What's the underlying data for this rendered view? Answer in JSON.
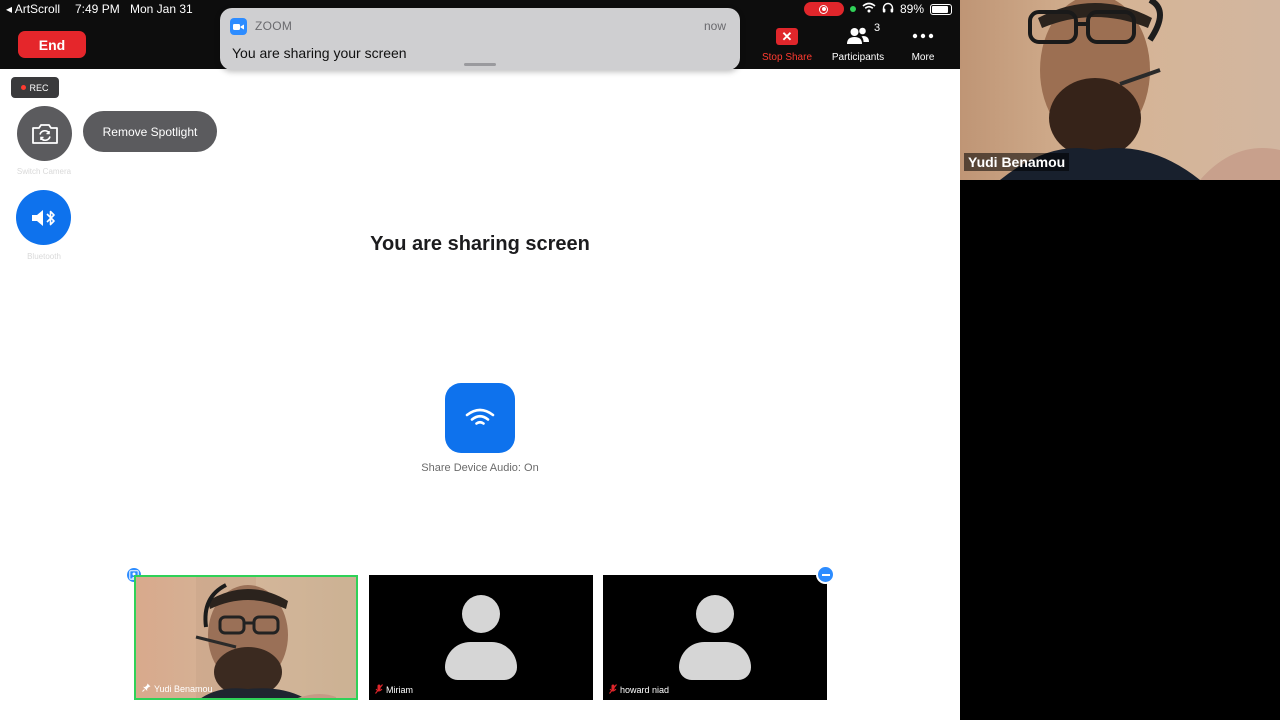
{
  "status_bar": {
    "back_app": "◂ ArtScroll",
    "time": "7:49 PM",
    "date": "Mon Jan 31",
    "battery": "89%"
  },
  "end_button": "End",
  "notification": {
    "app": "ZOOM",
    "time": "now",
    "message": "You are sharing your screen"
  },
  "toolbar": {
    "stop_share": "Stop Share",
    "participants": "Participants",
    "participants_count": "3",
    "more": "More"
  },
  "controls": {
    "rec": "REC",
    "switch_camera_label": "Switch Camera",
    "bluetooth_label": "Bluetooth",
    "remove_spotlight": "Remove Spotlight"
  },
  "main": {
    "title": "You are sharing screen",
    "audio_label": "Share Device Audio: On"
  },
  "thumbnails": [
    {
      "name": "Yudi Benamou"
    },
    {
      "name": "Miriam"
    },
    {
      "name": "howard niad"
    }
  ],
  "webcam": {
    "name": "Yudi Benamou"
  },
  "colors": {
    "accent_blue": "#0e72ed",
    "end_red": "#e5262b",
    "active_speaker_green": "#2fd158"
  }
}
